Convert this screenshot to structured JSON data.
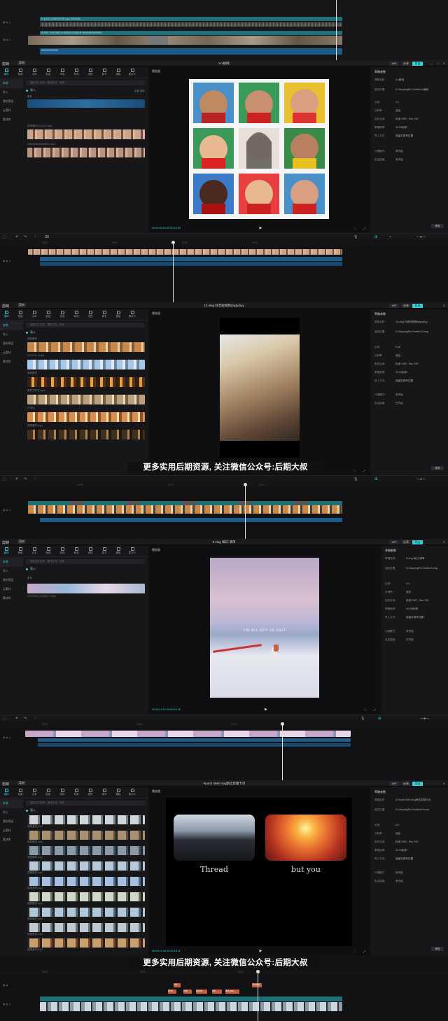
{
  "top_strip": {
    "clip1_label": "tu jj 2021106878CHD.mp4 0000035",
    "clip2_label": "9I 9I9I · 9I9I I9IIE 9I I9I9IO9JOI6I9I9I 9I9I9I9IE9I9IE9I9I",
    "audio_label": "9I9II9I9I9IE9I9I"
  },
  "editor1": {
    "app": "剪映",
    "menu": "菜单",
    "title": "8-x格网",
    "pro": "VIP",
    "share": "分享",
    "export": "导出",
    "tools": [
      "媒体",
      "音频",
      "文本",
      "贴纸",
      "特效",
      "转场",
      "滤镜",
      "调节",
      "模板",
      "数字人"
    ],
    "side": [
      "本地",
      "导入",
      "我的预设",
      "云素材",
      "素材库"
    ],
    "search_placeholder": "搜索文件名称、素材名称、标签",
    "import_label": "导入",
    "sort": "全部  排序",
    "files": [
      "素材",
      "剪映素材2023123.mp4",
      "3b8d96ab9d6ed55f1.mp4"
    ],
    "player_title": "播放器",
    "timecode": "00:00:06:23   00:00:10:23",
    "prop_title": "草稿参数",
    "props": [
      {
        "k": "草稿名称:",
        "v": "3-x格网"
      },
      {
        "k": "保存位置:",
        "v": "D:/JianyingPro Drafts/3-x格网"
      },
      {
        "k": "比例:",
        "v": "1:1"
      },
      {
        "k": "分辨率:",
        "v": "适应"
      },
      {
        "k": "色彩空间:",
        "v": "标准 SDR - Rec.709"
      },
      {
        "k": "草稿帧率:",
        "v": "30.00帧/秒"
      },
      {
        "k": "导入方式:",
        "v": "保留在原有位置"
      },
      {
        "k": "代理模式:",
        "v": "未开启"
      },
      {
        "k": "自由层级:",
        "v": "未开启"
      }
    ],
    "modify": "修改"
  },
  "editor2": {
    "title": "13-vlog 抖音短视频daylydryy",
    "files": [
      "视频素材",
      "2020001.1.mp4",
      "视频素材",
      "素材文件名.mp4",
      "已添加",
      "视频素材.mp4"
    ],
    "timecode": "00:00:11:29   00:00:23:11",
    "props": [
      {
        "k": "草稿名称:",
        "v": "13-vlog 抖音短视频daylydryy"
      },
      {
        "k": "保存位置:",
        "v": "D:/JianyingPro Drafts/13-vlog"
      },
      {
        "k": "比例:",
        "v": "9:16"
      },
      {
        "k": "分辨率:",
        "v": "适应"
      },
      {
        "k": "色彩空间:",
        "v": "标准 SDR - Rec.709"
      },
      {
        "k": "草稿帧率:",
        "v": "30.00帧/秒"
      },
      {
        "k": "导入方式:",
        "v": "保留在原有位置"
      },
      {
        "k": "代理模式:",
        "v": "未开启"
      },
      {
        "k": "自由层级:",
        "v": "已开启"
      }
    ],
    "subtitle": "更多实用后期资源, 关注微信公众号:后期大叔"
  },
  "editor3": {
    "title": "9-vlog 每日·清单",
    "files": [
      "素材",
      "20200928_114453_9.mp4"
    ],
    "overlay_text": "I'M ALL OUT OF SALT",
    "timecode": "00:00:11:24   00:00:14:29",
    "props": [
      {
        "k": "草稿名称:",
        "v": "9-vlog 每日·清单"
      },
      {
        "k": "保存位置:",
        "v": "D:/JianyingPro Drafts/9-vlog"
      },
      {
        "k": "比例:",
        "v": "3:4"
      },
      {
        "k": "分辨率:",
        "v": "适应"
      },
      {
        "k": "色彩空间:",
        "v": "标准 SDR - Rec.709"
      },
      {
        "k": "草稿帧率:",
        "v": "30.00帧/秒"
      },
      {
        "k": "导入方式:",
        "v": "保留在原有位置"
      },
      {
        "k": "代理模式:",
        "v": "未开启"
      },
      {
        "k": "自由层级:",
        "v": "已开启"
      }
    ]
  },
  "editor4": {
    "title": "-Numb 0Min lsvg跑位剪辑卡点",
    "files": [
      "视频素材.mp4",
      "视频素材.mp4",
      "视频素材.mp4",
      "视频素材.mp4",
      "视频素材.mp4",
      "视频素材.mp4",
      "视频素材.mp4",
      "视频素材.mp4",
      "视频素材.mp4",
      "视频素材.mp4"
    ],
    "caption_left": "Thread",
    "caption_right": "but you",
    "timecode": "00:00:10:16   00:00:15:11",
    "props": [
      {
        "k": "草稿名称:",
        "v": "6-Numb 0Min lsvg跑位剪辑卡点"
      },
      {
        "k": "保存位置:",
        "v": "D:/JianyingPro Drafts/6-Numb"
      },
      {
        "k": "比例:",
        "v": "4:3"
      },
      {
        "k": "分辨率:",
        "v": "适应"
      },
      {
        "k": "色彩空间:",
        "v": "标准 SDR - Rec.709"
      },
      {
        "k": "草稿帧率:",
        "v": "30.00帧/秒"
      },
      {
        "k": "导入方式:",
        "v": "保留在原有位置"
      },
      {
        "k": "代理模式:",
        "v": "未开启"
      },
      {
        "k": "自由层级:",
        "v": "未开启"
      }
    ],
    "text_clips": [
      "Sal",
      "SHe",
      "She",
      "Numb",
      "Sel",
      "Bet you",
      "Thread"
    ],
    "subtitle": "更多实用后期资源, 关注微信公众号:后期大叔"
  },
  "ruler_ticks": [
    "00:00",
    "00:05",
    "00:10",
    "00:15",
    "00:20",
    "00:25",
    "00:30",
    "00:35"
  ],
  "colors": {
    "accent": "#3ad0d6",
    "track_video": "#1f6f78",
    "track_audio": "#1b5c8c",
    "bg": "#121214"
  }
}
